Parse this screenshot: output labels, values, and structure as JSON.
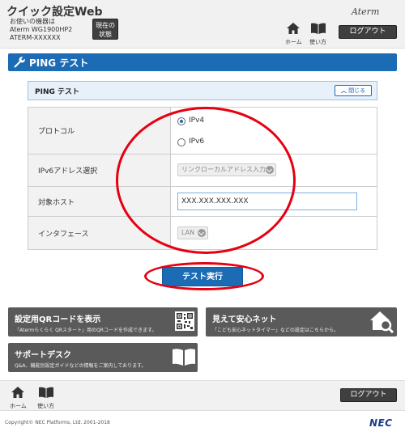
{
  "header": {
    "app_title": "クイック設定Web",
    "device_label": "お使いの機器は",
    "device_model": "Aterm WG1900HP2",
    "device_ssid": "ATERM-XXXXXX",
    "status_button": [
      "現在の",
      "状態"
    ],
    "brand": "Aterm",
    "home_label": "ホーム",
    "manual_label": "使い方",
    "logout_label": "ログアウト"
  },
  "section": {
    "title": "PING テスト",
    "icon": "wrench-icon"
  },
  "panel": {
    "title": "PING テスト",
    "close_label": "閉じる"
  },
  "form": {
    "protocol": {
      "label": "プロトコル",
      "options": [
        "IPv4",
        "IPv6"
      ],
      "selected": "IPv4"
    },
    "ipv6_address": {
      "label": "IPv6アドレス選択",
      "value": "リンクローカルアドレス入力"
    },
    "target_host": {
      "label": "対象ホスト",
      "value": "XXX.XXX.XXX.XXX"
    },
    "interface": {
      "label": "インタフェース",
      "value": "LAN"
    }
  },
  "run_button": "テスト実行",
  "links": [
    {
      "title": "設定用QRコードを表示",
      "desc": "「Atermらくらく QRスタート」用のQRコードを作成できます。",
      "icon": "qr-code-icon"
    },
    {
      "title": "見えて安心ネット",
      "desc": "「こども安心ネットタイマー」などの設定はこちらから。",
      "icon": "house-search-icon"
    },
    {
      "title": "サポートデスク",
      "desc": "Q&A、機能別設定ガイドなどの情報をご案内しております。",
      "icon": "book-icon"
    }
  ],
  "footer": {
    "home_label": "ホーム",
    "manual_label": "使い方",
    "logout_label": "ログアウト",
    "copyright": "Copyright© NEC Platforms, Ltd. 2001-2018",
    "logo": "NEC"
  },
  "colors": {
    "accent": "#1c6bb5",
    "annotation": "#e60012",
    "dark_button": "#3f3f3f",
    "link_box": "#5a5a5a"
  }
}
